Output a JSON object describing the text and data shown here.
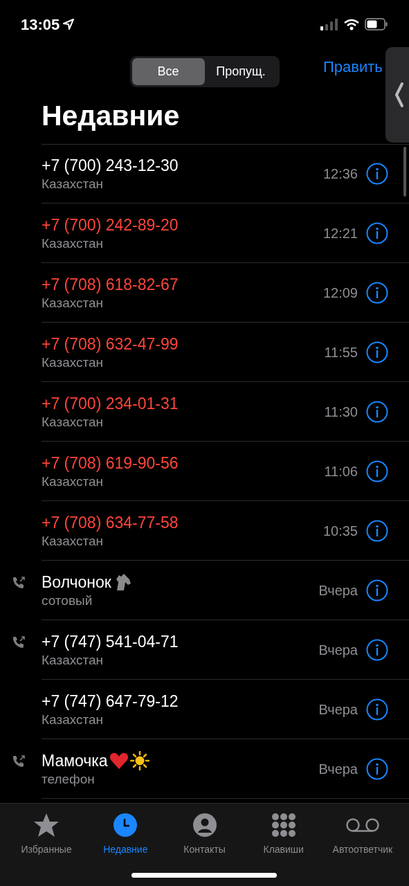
{
  "status_bar": {
    "time": "13:05"
  },
  "segments": [
    {
      "label": "Все",
      "selected": true
    },
    {
      "label": "Пропущ.",
      "selected": false
    }
  ],
  "edit_button": "Править",
  "title": "Недавние",
  "calls": [
    {
      "name": "+7 (700) 243-12-30",
      "detail": "Казахстан",
      "time": "12:36",
      "missed": false,
      "outgoing": false
    },
    {
      "name": "+7 (700) 242-89-20",
      "detail": "Казахстан",
      "time": "12:21",
      "missed": true,
      "outgoing": false
    },
    {
      "name": "+7 (708) 618-82-67",
      "detail": "Казахстан",
      "time": "12:09",
      "missed": true,
      "outgoing": false
    },
    {
      "name": "+7 (708) 632-47-99",
      "detail": "Казахстан",
      "time": "11:55",
      "missed": true,
      "outgoing": false
    },
    {
      "name": "+7 (700) 234-01-31",
      "detail": "Казахстан",
      "time": "11:30",
      "missed": true,
      "outgoing": false
    },
    {
      "name": "+7 (708) 619-90-56",
      "detail": "Казахстан",
      "time": "11:06",
      "missed": true,
      "outgoing": false
    },
    {
      "name": "+7 (708) 634-77-58",
      "detail": "Казахстан",
      "time": "10:35",
      "missed": true,
      "outgoing": false
    },
    {
      "name": "Волчонок",
      "emoji": [
        {
          "kind": "horse"
        }
      ],
      "detail": "сотовый",
      "time": "Вчера",
      "missed": false,
      "outgoing": true
    },
    {
      "name": "+7 (747) 541-04-71",
      "detail": "Казахстан",
      "time": "Вчера",
      "missed": false,
      "outgoing": true
    },
    {
      "name": "+7 (747) 647-79-12",
      "detail": "Казахстан",
      "time": "Вчера",
      "missed": false,
      "outgoing": false
    },
    {
      "name": "Мамочка",
      "emoji": [
        {
          "kind": "heart"
        },
        {
          "kind": "sun"
        }
      ],
      "detail": "телефон",
      "time": "Вчера",
      "missed": false,
      "outgoing": true
    }
  ],
  "tab_bar": [
    {
      "label": "Избранные",
      "kind": "star",
      "selected": false
    },
    {
      "label": "Недавние",
      "kind": "clock",
      "selected": true
    },
    {
      "label": "Контакты",
      "kind": "person",
      "selected": false
    },
    {
      "label": "Клавиши",
      "kind": "keypad",
      "selected": false
    },
    {
      "label": "Автоответчик",
      "kind": "voicemail",
      "selected": false
    }
  ]
}
